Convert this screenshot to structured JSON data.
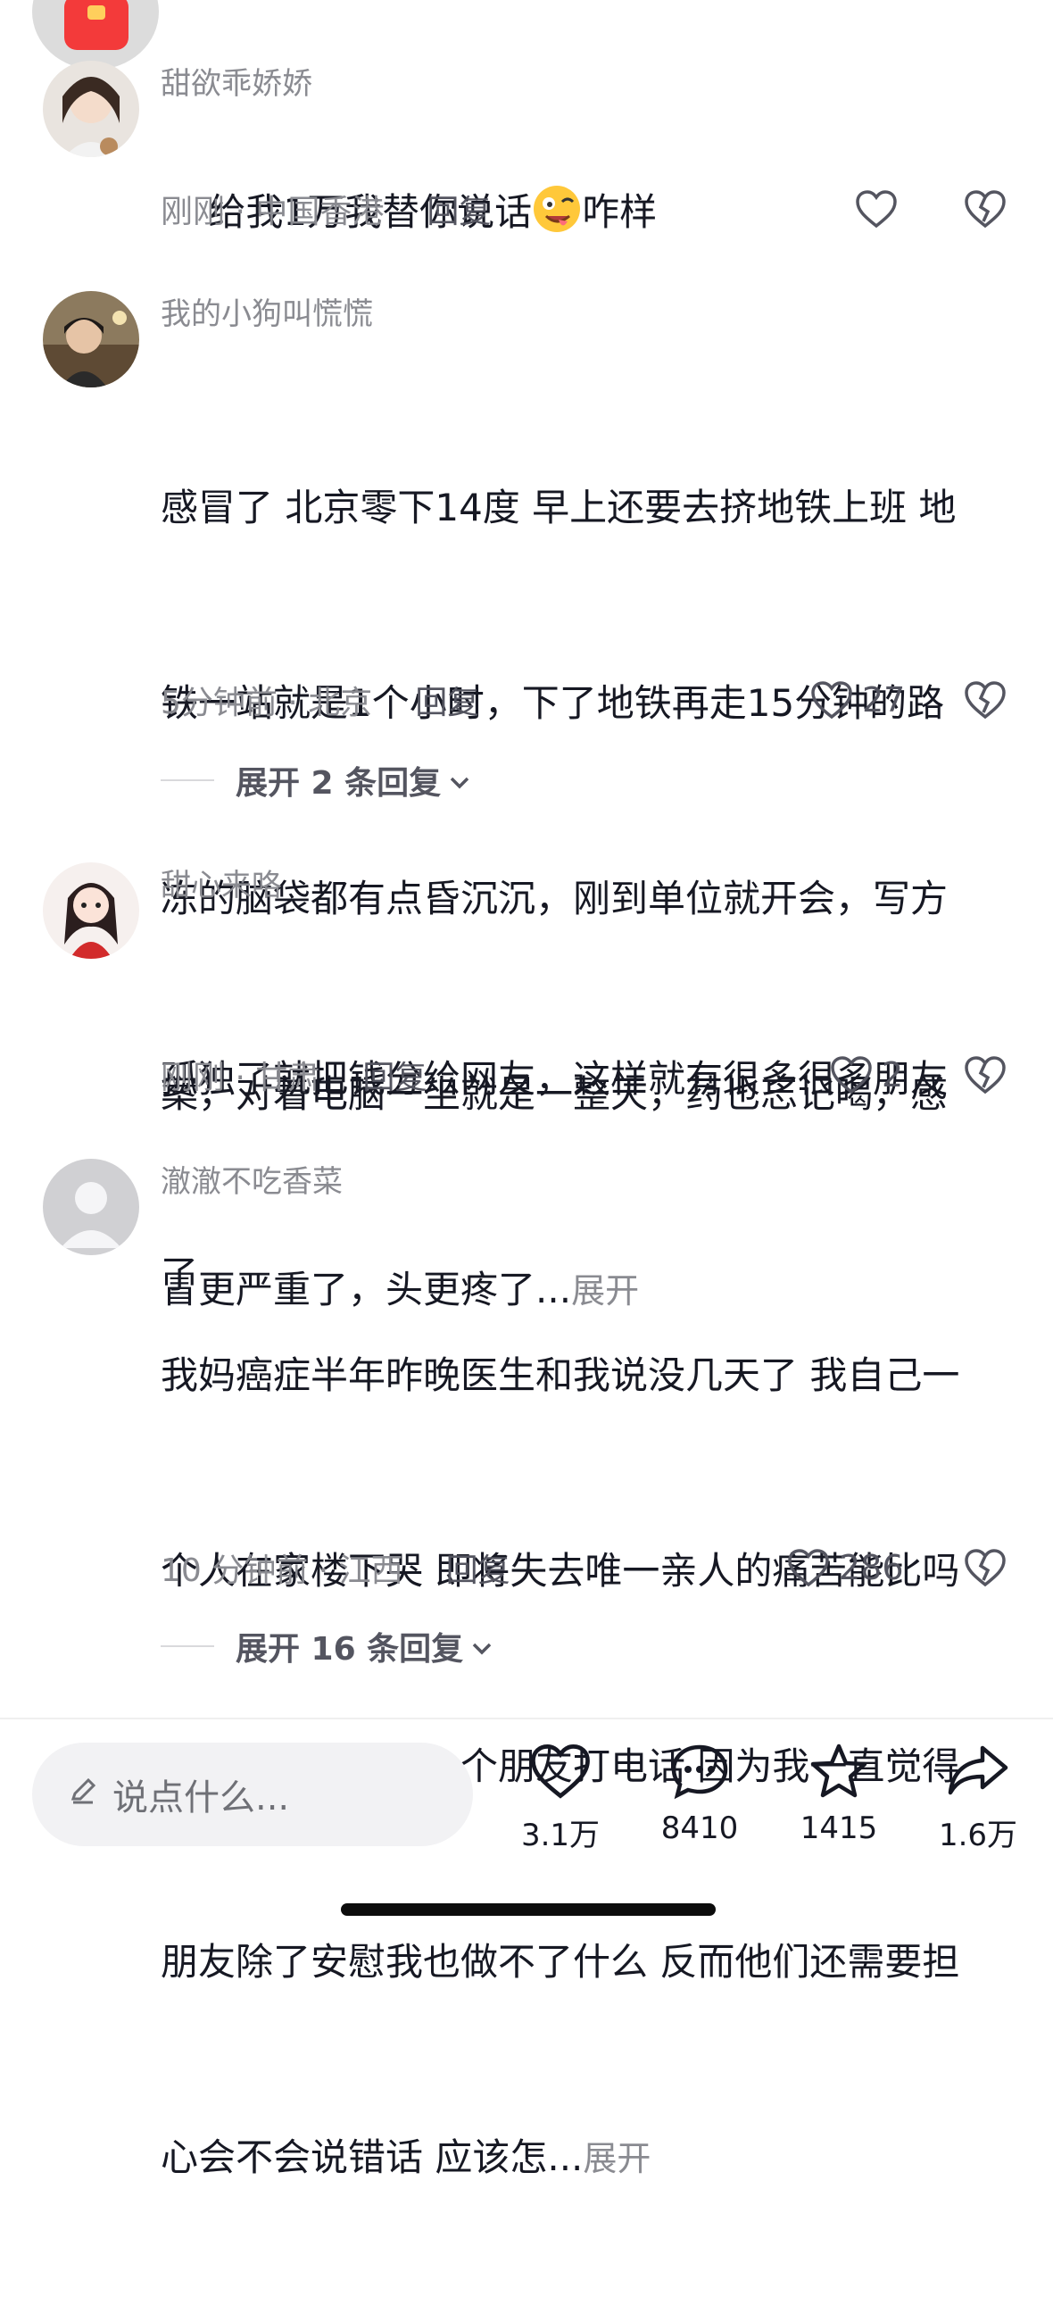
{
  "comments": [
    {
      "username": "甜欲乖娇娇",
      "content_before_emoji": "给我1万我替你说话",
      "emoji": "crazy-face-emoji",
      "content_after_emoji": "咋样",
      "meta": "刚刚 · 中国香港",
      "reply_label": "回复",
      "likes": ""
    },
    {
      "username": "我的小狗叫慌慌",
      "content_lines": [
        "感冒了 北京零下14度 早上还要去挤地铁上班 地",
        "铁一站就是1个小时，下了地铁再走15分钟的路",
        "冻的脑袋都有点昏沉沉，刚到单位就开会，写方",
        "案，对着电脑一坐就是一整天，药也忘记喝，感",
        "冒更严重了，头更疼了..."
      ],
      "expand_inline": "展开",
      "meta": "5分钟前 · 北京",
      "reply_label": "回复",
      "likes": "27",
      "expand_replies": "展开 2 条回复"
    },
    {
      "username": "甜心来咯",
      "content_lines": [
        "孤独了就把钱分给网友，这样就有很多很多朋友",
        "了"
      ],
      "meta": "刚刚 · 甘肃",
      "reply_label": "回复",
      "likes": "2"
    },
    {
      "username": "澈澈不吃香菜",
      "content_lines": [
        "我妈癌症半年昨晚医生和我说没几天了 我自己一",
        "个人在家楼下哭 即将失去唯一亲人的痛苦能比吗",
        "但我不敢和任何一个朋友打电话 因为我一直觉得",
        "朋友除了安慰我也做不了什么 反而他们还需要担",
        "心会不会说错话 应该怎..."
      ],
      "expand_inline": "展开",
      "meta": "10 分钟前 · 江西",
      "reply_label": "回复",
      "likes": "286",
      "expand_replies": "展开 16 条回复"
    }
  ],
  "bottom_bar": {
    "input_placeholder": "说点什么...",
    "like_count": "3.1万",
    "comment_count": "8410",
    "favorite_count": "1415",
    "share_count": "1.6万"
  },
  "colors": {
    "text_primary": "#161823",
    "text_secondary": "#8a8b91",
    "envelope_red": "#f33a3a"
  }
}
